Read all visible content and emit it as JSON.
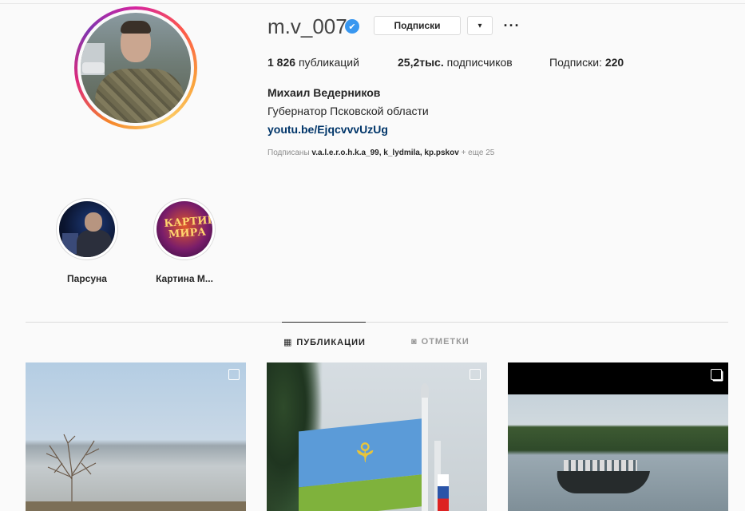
{
  "profile": {
    "username": "m.v_007",
    "verified_icon": "✔",
    "follow_button_label": "Подписки",
    "dropdown_icon": "▾",
    "more_icon": "···",
    "stats": {
      "posts_value": "1 826",
      "posts_label": "публикаций",
      "followers_value": "25,2тыс.",
      "followers_label": "подписчиков",
      "following_label": "Подписки:",
      "following_value": "220"
    },
    "full_name": "Михаил Ведерников",
    "bio": "Губернатор Псковской области",
    "link": "youtu.be/EjqcvvvUzUg",
    "followed_by_prefix": "Подписаны",
    "followed_by_names": "v.a.l.e.r.o.h.k.a_99, k_lydmila, kp.pskov",
    "followed_by_more": "+ еще 25"
  },
  "highlights": [
    {
      "label": "Парсуна"
    },
    {
      "label": "Картина М..."
    }
  ],
  "highlight2_art_text": "КАРТИНА МИРА",
  "tabs": {
    "posts": {
      "icon": "▦",
      "label": "ПУБЛИКАЦИИ"
    },
    "tagged": {
      "icon": "◙",
      "label": "ОТМЕТКИ"
    }
  },
  "colors": {
    "link": "#003569",
    "verified": "#3897f0",
    "muted": "#8e8e8e",
    "background": "#fafafa"
  },
  "icons": {
    "verified": "verified-badge-icon",
    "dropdown": "chevron-down-icon",
    "more": "ellipsis-icon",
    "grid": "grid-icon",
    "tagged": "tagged-icon",
    "multi_post": "carousel-icon"
  }
}
